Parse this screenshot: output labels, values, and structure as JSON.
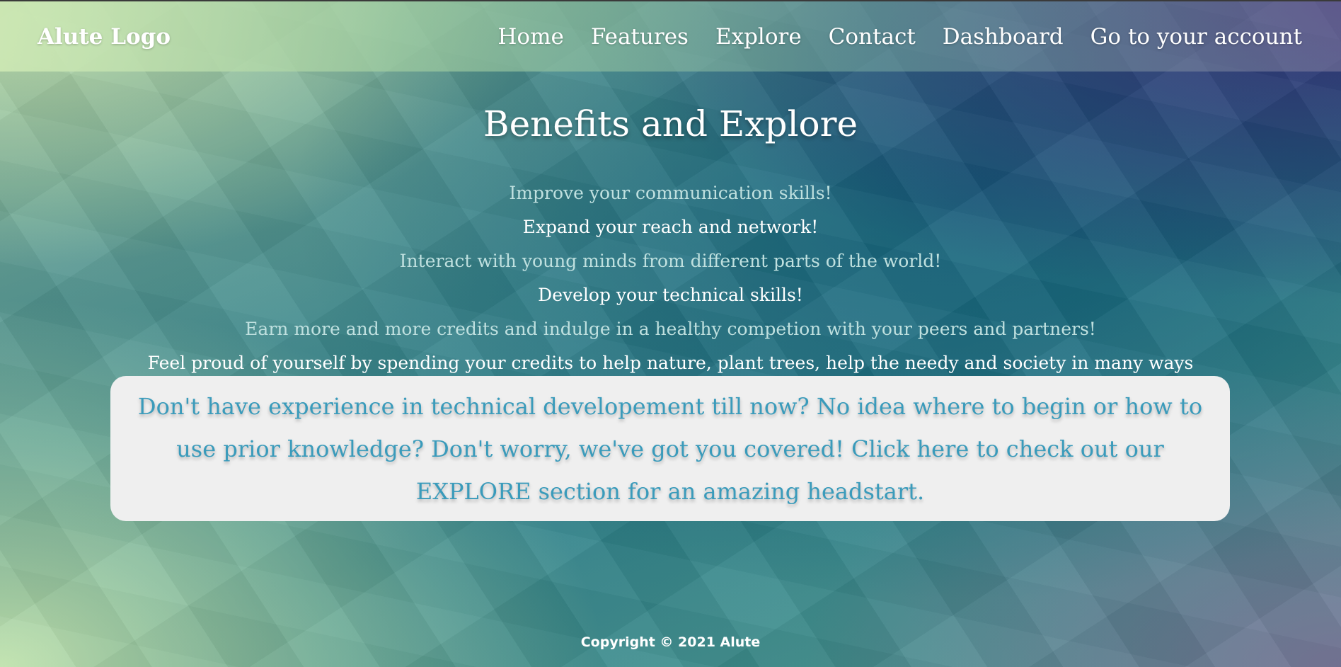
{
  "header": {
    "logo": "Alute Logo",
    "nav": [
      "Home",
      "Features",
      "Explore",
      "Contact",
      "Dashboard",
      "Go to your account"
    ]
  },
  "main": {
    "title": "Benefits and Explore",
    "benefits": [
      "Improve your communication skills!",
      "Expand your reach and network!",
      "Interact with young minds from different parts of the world!",
      "Develop your technical skills!",
      "Earn more and more credits and indulge in a healthy competion with your peers and partners!",
      "Feel proud of yourself by spending your credits to help nature, plant trees, help the needy and society in many ways such as making donations and becoming a part of campaigns... all with just one click and not spending real cash!"
    ],
    "cta": "Don't have experience in technical developement till now? No idea where to begin or how to use prior knowledge? Don't worry, we've got you covered! Click here to check out our EXPLORE section for an amazing headstart."
  },
  "footer": {
    "copyright": "Copyright © 2021 Alute"
  },
  "colors": {
    "cta_text": "#3a9bbb",
    "cta_background": "#efefef",
    "muted_text": "#bfe0df"
  }
}
